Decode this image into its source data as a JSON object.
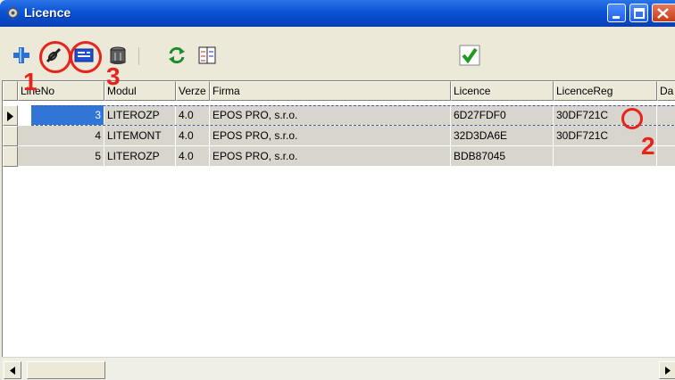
{
  "window": {
    "title": "Licence",
    "icon": "gear-icon"
  },
  "toolbar": {
    "tools": [
      {
        "name": "add-icon"
      },
      {
        "name": "edit-icon"
      },
      {
        "name": "card-icon"
      },
      {
        "name": "delete-icon"
      },
      {
        "name": "refresh-icon"
      },
      {
        "name": "columns-icon"
      },
      {
        "name": "confirm-icon"
      }
    ]
  },
  "annotations": {
    "labels": [
      "1",
      "2",
      "3"
    ],
    "color": "#e8231c"
  },
  "grid": {
    "columns": [
      "LineNo",
      "Modul",
      "Verze",
      "Firma",
      "Licence",
      "LicenceReg",
      "Da"
    ],
    "rows": [
      {
        "lineno": "3",
        "modul": "LITEROZP",
        "verze": "4.0",
        "firma": "EPOS PRO, s.r.o.",
        "licence": "6D27FDF0",
        "licencereg": "30DF721C"
      },
      {
        "lineno": "4",
        "modul": "LITEMONT",
        "verze": "4.0",
        "firma": "EPOS PRO, s.r.o.",
        "licence": "32D3DA6E",
        "licencereg": "30DF721C"
      },
      {
        "lineno": "5",
        "modul": "LITEROZP",
        "verze": "4.0",
        "firma": "EPOS PRO, s.r.o.",
        "licence": "BDB87045",
        "licencereg": ""
      }
    ],
    "selected_color": "#3175d6"
  }
}
